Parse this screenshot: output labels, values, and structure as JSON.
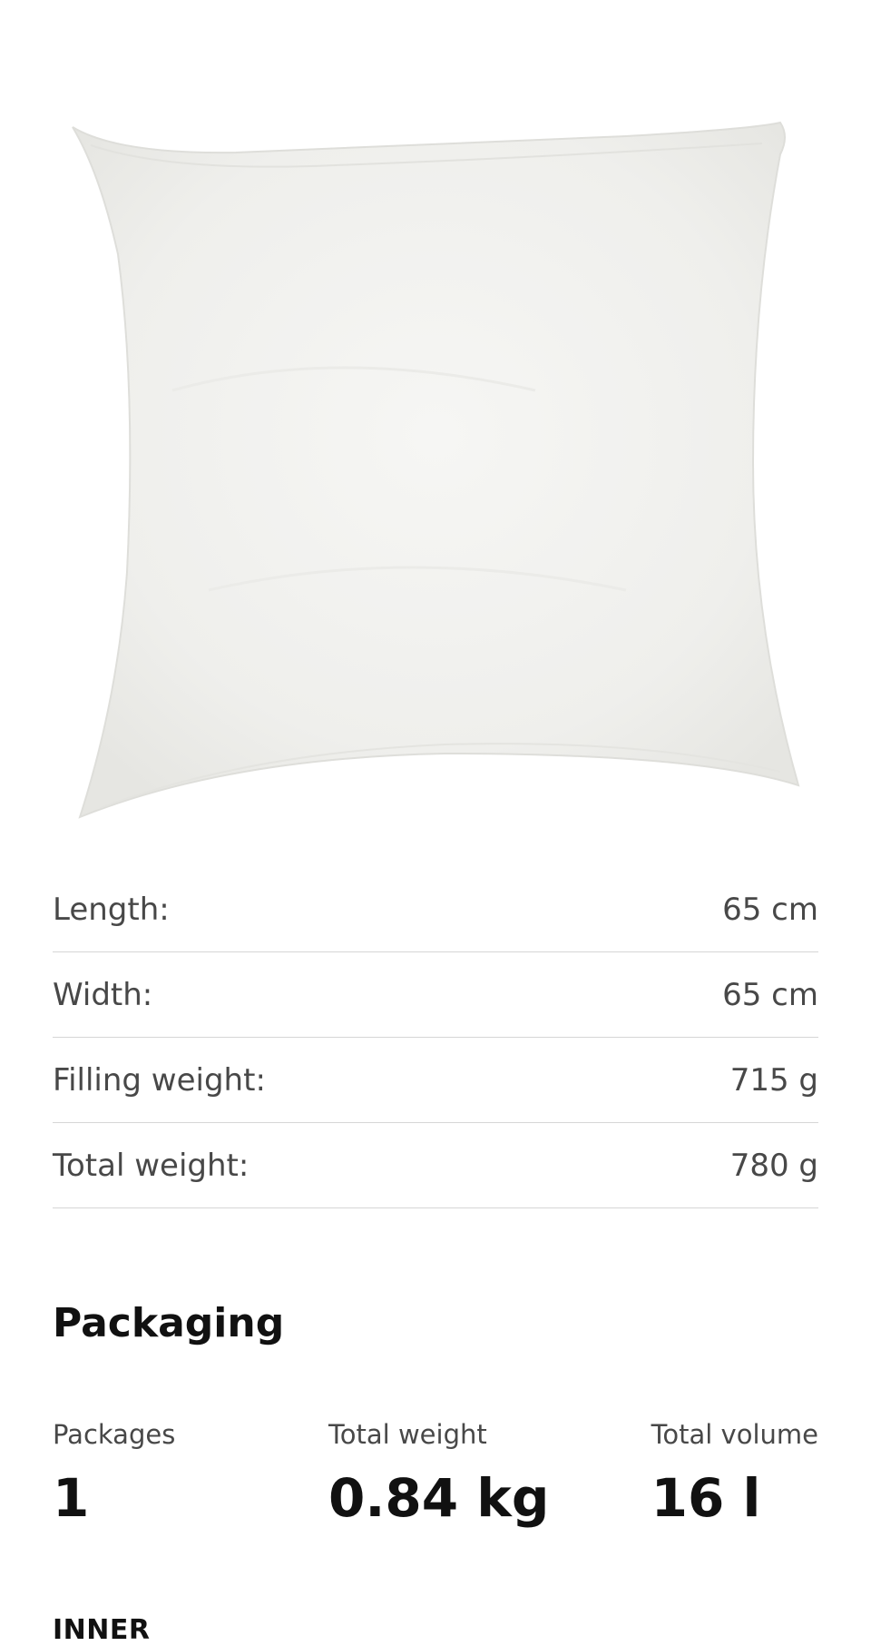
{
  "dimensions": [
    {
      "label": "Length:",
      "value": "65 cm"
    },
    {
      "label": "Width:",
      "value": "65 cm"
    },
    {
      "label": "Filling weight:",
      "value": "715 g"
    },
    {
      "label": "Total weight:",
      "value": "780 g"
    }
  ],
  "packaging": {
    "title": "Packaging",
    "stats": [
      {
        "label": "Packages",
        "value": "1"
      },
      {
        "label": "Total weight",
        "value": "0.84 kg"
      },
      {
        "label": "Total volume",
        "value": "16 l"
      }
    ]
  },
  "inner_label": "INNER",
  "colors": {
    "divider": "#d6d6d6",
    "label_text": "#484848",
    "heading_text": "#111111",
    "pillow": "#f3f3f1"
  }
}
